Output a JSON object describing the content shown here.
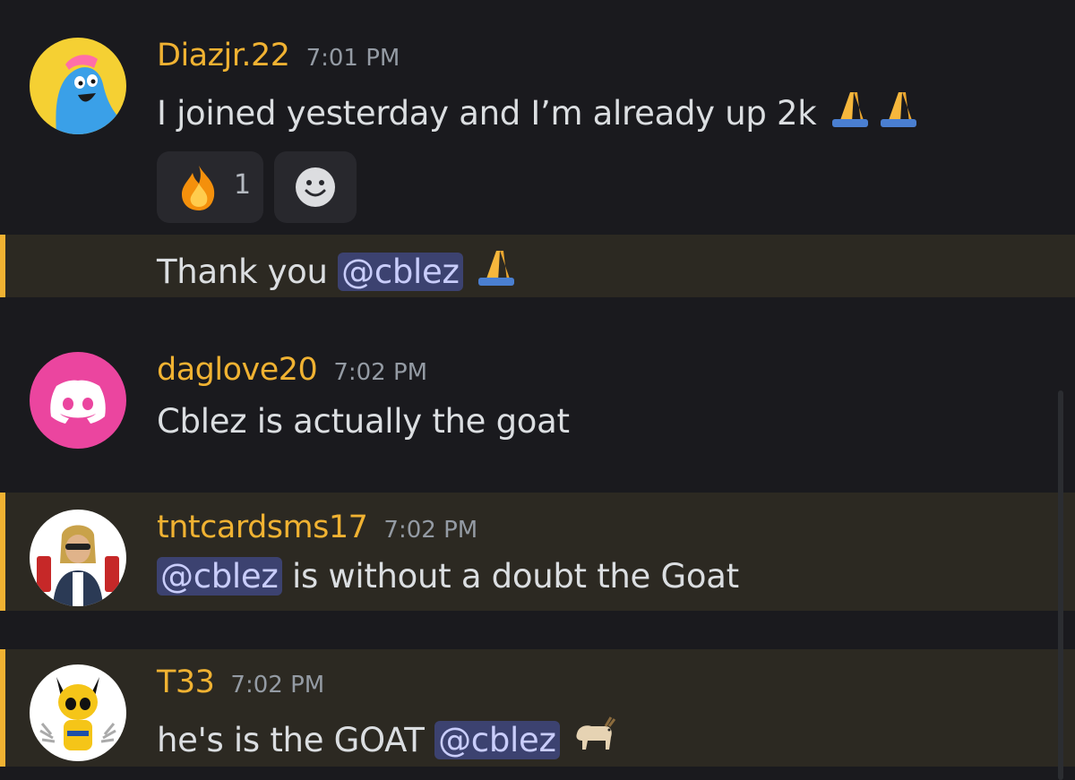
{
  "messages": [
    {
      "username": "Diazjr.22",
      "time": "7:01 PM",
      "text": "I joined yesterday and I’m already up 2k",
      "reactions": [
        {
          "emoji": "fire-emoji",
          "count": "1"
        }
      ],
      "avatar": "blue-creature-avatar"
    },
    {
      "continuation": true,
      "text_before": "Thank you",
      "mention": "@cblez"
    },
    {
      "username": "daglove20",
      "time": "7:02 PM",
      "text": "Cblez is actually the goat",
      "avatar": "discord-default-avatar"
    },
    {
      "username": "tntcardsms17",
      "time": "7:02 PM",
      "mention": "@cblez",
      "text_after": "is without a doubt the Goat",
      "avatar": "dynamite-character-avatar"
    },
    {
      "username": "T33",
      "time": "7:02 PM",
      "text_before": "he's is the GOAT",
      "mention": "@cblez",
      "avatar": "wolverine-avatar"
    }
  ],
  "colors": {
    "background": "#1a1a1e",
    "highlight": "#2c2922",
    "highlight_bar": "#f0b232",
    "username": "#f0b232",
    "mention_bg": "#3c4270"
  }
}
